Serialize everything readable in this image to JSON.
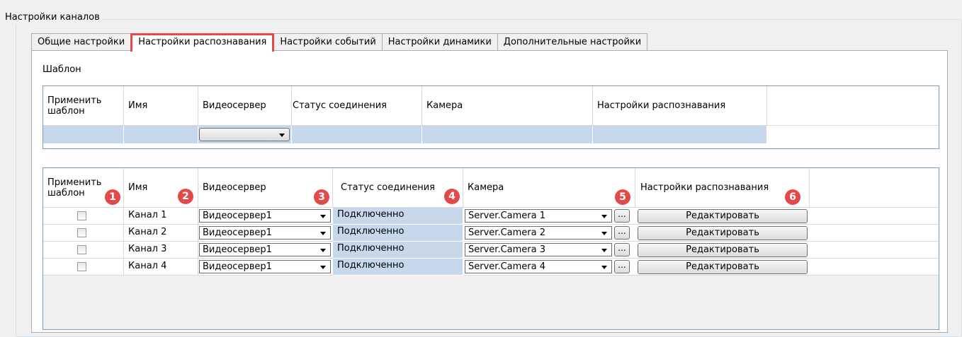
{
  "group_title": "Настройки каналов",
  "tabs": [
    {
      "label": "Общие настройки",
      "active": false
    },
    {
      "label": "Настройки распознавания",
      "active": true
    },
    {
      "label": "Настройки событий",
      "active": false
    },
    {
      "label": "Настройки динамики",
      "active": false
    },
    {
      "label": "Дополнительные настройки",
      "active": false
    }
  ],
  "template_section_label": "Шаблон",
  "columns": {
    "apply_template": "Применить шаблон",
    "name": "Имя",
    "videoserver": "Видеосервер",
    "connection_status": "Статус соединения",
    "camera": "Камера",
    "recognition_settings": "Настройки распознавания"
  },
  "markers": [
    "1",
    "2",
    "3",
    "4",
    "5",
    "6"
  ],
  "channels": [
    {
      "name": "Канал 1",
      "videoserver": "Видеосервер1",
      "status": "Подключенно",
      "camera": "Server.Camera 1",
      "button": "Редактировать",
      "checked": false
    },
    {
      "name": "Канал 2",
      "videoserver": "Видеосервер1",
      "status": "Подключенно",
      "camera": "Server.Camera 2",
      "button": "Редактировать",
      "checked": false
    },
    {
      "name": "Канал 3",
      "videoserver": "Видеосервер1",
      "status": "Подключенно",
      "camera": "Server.Camera 3",
      "button": "Редактировать",
      "checked": false
    },
    {
      "name": "Канал 4",
      "videoserver": "Видеосервер1",
      "status": "Подключенно",
      "camera": "Server.Camera 4",
      "button": "Редактировать",
      "checked": false
    }
  ],
  "ellipsis_label": "...",
  "colors": {
    "highlight": "#e24a4a",
    "row_blue": "#c7d8ec",
    "grid_border": "#7f9db9"
  }
}
